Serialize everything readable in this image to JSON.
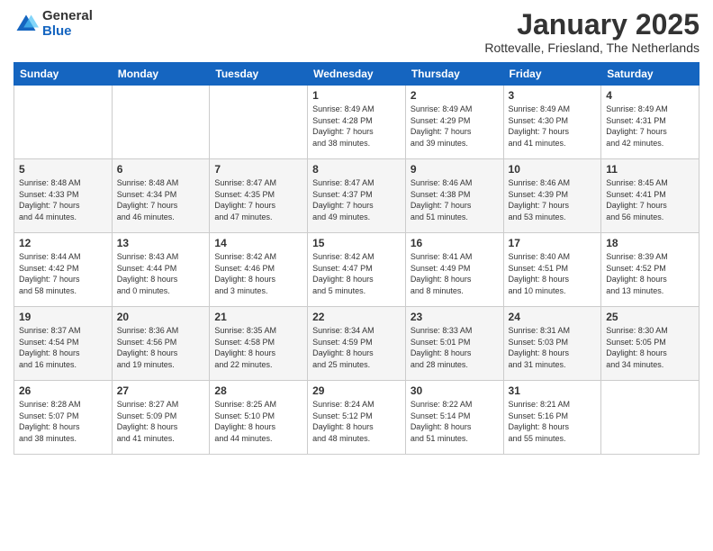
{
  "logo": {
    "general": "General",
    "blue": "Blue"
  },
  "header": {
    "month": "January 2025",
    "location": "Rottevalle, Friesland, The Netherlands"
  },
  "days_of_week": [
    "Sunday",
    "Monday",
    "Tuesday",
    "Wednesday",
    "Thursday",
    "Friday",
    "Saturday"
  ],
  "weeks": [
    [
      {
        "day": "",
        "info": ""
      },
      {
        "day": "",
        "info": ""
      },
      {
        "day": "",
        "info": ""
      },
      {
        "day": "1",
        "info": "Sunrise: 8:49 AM\nSunset: 4:28 PM\nDaylight: 7 hours\nand 38 minutes."
      },
      {
        "day": "2",
        "info": "Sunrise: 8:49 AM\nSunset: 4:29 PM\nDaylight: 7 hours\nand 39 minutes."
      },
      {
        "day": "3",
        "info": "Sunrise: 8:49 AM\nSunset: 4:30 PM\nDaylight: 7 hours\nand 41 minutes."
      },
      {
        "day": "4",
        "info": "Sunrise: 8:49 AM\nSunset: 4:31 PM\nDaylight: 7 hours\nand 42 minutes."
      }
    ],
    [
      {
        "day": "5",
        "info": "Sunrise: 8:48 AM\nSunset: 4:33 PM\nDaylight: 7 hours\nand 44 minutes."
      },
      {
        "day": "6",
        "info": "Sunrise: 8:48 AM\nSunset: 4:34 PM\nDaylight: 7 hours\nand 46 minutes."
      },
      {
        "day": "7",
        "info": "Sunrise: 8:47 AM\nSunset: 4:35 PM\nDaylight: 7 hours\nand 47 minutes."
      },
      {
        "day": "8",
        "info": "Sunrise: 8:47 AM\nSunset: 4:37 PM\nDaylight: 7 hours\nand 49 minutes."
      },
      {
        "day": "9",
        "info": "Sunrise: 8:46 AM\nSunset: 4:38 PM\nDaylight: 7 hours\nand 51 minutes."
      },
      {
        "day": "10",
        "info": "Sunrise: 8:46 AM\nSunset: 4:39 PM\nDaylight: 7 hours\nand 53 minutes."
      },
      {
        "day": "11",
        "info": "Sunrise: 8:45 AM\nSunset: 4:41 PM\nDaylight: 7 hours\nand 56 minutes."
      }
    ],
    [
      {
        "day": "12",
        "info": "Sunrise: 8:44 AM\nSunset: 4:42 PM\nDaylight: 7 hours\nand 58 minutes."
      },
      {
        "day": "13",
        "info": "Sunrise: 8:43 AM\nSunset: 4:44 PM\nDaylight: 8 hours\nand 0 minutes."
      },
      {
        "day": "14",
        "info": "Sunrise: 8:42 AM\nSunset: 4:46 PM\nDaylight: 8 hours\nand 3 minutes."
      },
      {
        "day": "15",
        "info": "Sunrise: 8:42 AM\nSunset: 4:47 PM\nDaylight: 8 hours\nand 5 minutes."
      },
      {
        "day": "16",
        "info": "Sunrise: 8:41 AM\nSunset: 4:49 PM\nDaylight: 8 hours\nand 8 minutes."
      },
      {
        "day": "17",
        "info": "Sunrise: 8:40 AM\nSunset: 4:51 PM\nDaylight: 8 hours\nand 10 minutes."
      },
      {
        "day": "18",
        "info": "Sunrise: 8:39 AM\nSunset: 4:52 PM\nDaylight: 8 hours\nand 13 minutes."
      }
    ],
    [
      {
        "day": "19",
        "info": "Sunrise: 8:37 AM\nSunset: 4:54 PM\nDaylight: 8 hours\nand 16 minutes."
      },
      {
        "day": "20",
        "info": "Sunrise: 8:36 AM\nSunset: 4:56 PM\nDaylight: 8 hours\nand 19 minutes."
      },
      {
        "day": "21",
        "info": "Sunrise: 8:35 AM\nSunset: 4:58 PM\nDaylight: 8 hours\nand 22 minutes."
      },
      {
        "day": "22",
        "info": "Sunrise: 8:34 AM\nSunset: 4:59 PM\nDaylight: 8 hours\nand 25 minutes."
      },
      {
        "day": "23",
        "info": "Sunrise: 8:33 AM\nSunset: 5:01 PM\nDaylight: 8 hours\nand 28 minutes."
      },
      {
        "day": "24",
        "info": "Sunrise: 8:31 AM\nSunset: 5:03 PM\nDaylight: 8 hours\nand 31 minutes."
      },
      {
        "day": "25",
        "info": "Sunrise: 8:30 AM\nSunset: 5:05 PM\nDaylight: 8 hours\nand 34 minutes."
      }
    ],
    [
      {
        "day": "26",
        "info": "Sunrise: 8:28 AM\nSunset: 5:07 PM\nDaylight: 8 hours\nand 38 minutes."
      },
      {
        "day": "27",
        "info": "Sunrise: 8:27 AM\nSunset: 5:09 PM\nDaylight: 8 hours\nand 41 minutes."
      },
      {
        "day": "28",
        "info": "Sunrise: 8:25 AM\nSunset: 5:10 PM\nDaylight: 8 hours\nand 44 minutes."
      },
      {
        "day": "29",
        "info": "Sunrise: 8:24 AM\nSunset: 5:12 PM\nDaylight: 8 hours\nand 48 minutes."
      },
      {
        "day": "30",
        "info": "Sunrise: 8:22 AM\nSunset: 5:14 PM\nDaylight: 8 hours\nand 51 minutes."
      },
      {
        "day": "31",
        "info": "Sunrise: 8:21 AM\nSunset: 5:16 PM\nDaylight: 8 hours\nand 55 minutes."
      },
      {
        "day": "",
        "info": ""
      }
    ]
  ]
}
